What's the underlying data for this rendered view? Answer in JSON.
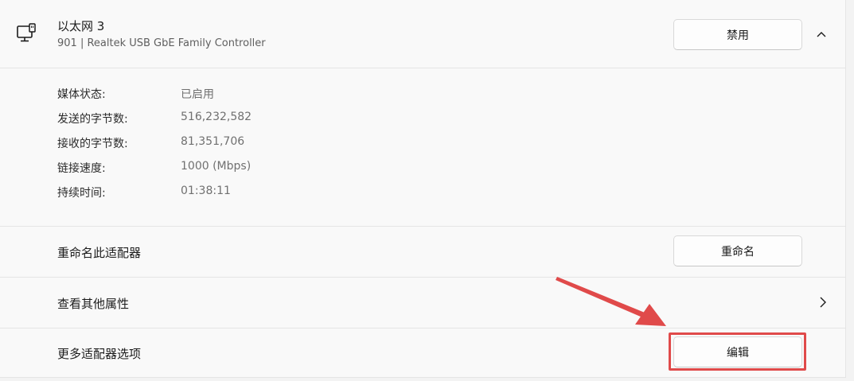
{
  "adapter": {
    "name": "以太网 3",
    "description": "901 | Realtek USB GbE Family Controller",
    "disable_label": "禁用",
    "icon": "ethernet-monitor-icon",
    "collapse_icon": "chevron-up-icon"
  },
  "stats": [
    {
      "label": "媒体状态:",
      "value": "已启用"
    },
    {
      "label": "发送的字节数:",
      "value": "516,232,582"
    },
    {
      "label": "接收的字节数:",
      "value": "81,351,706"
    },
    {
      "label": "链接速度:",
      "value": "1000 (Mbps)"
    },
    {
      "label": "持续时间:",
      "value": "01:38:11"
    }
  ],
  "actions": {
    "rename": {
      "label": "重命名此适配器",
      "button": "重命名"
    },
    "properties": {
      "label": "查看其他属性",
      "icon": "chevron-right-icon"
    },
    "more_options": {
      "label": "更多适配器选项",
      "button": "编辑"
    }
  },
  "annotation": {
    "color": "#e04a4a"
  }
}
